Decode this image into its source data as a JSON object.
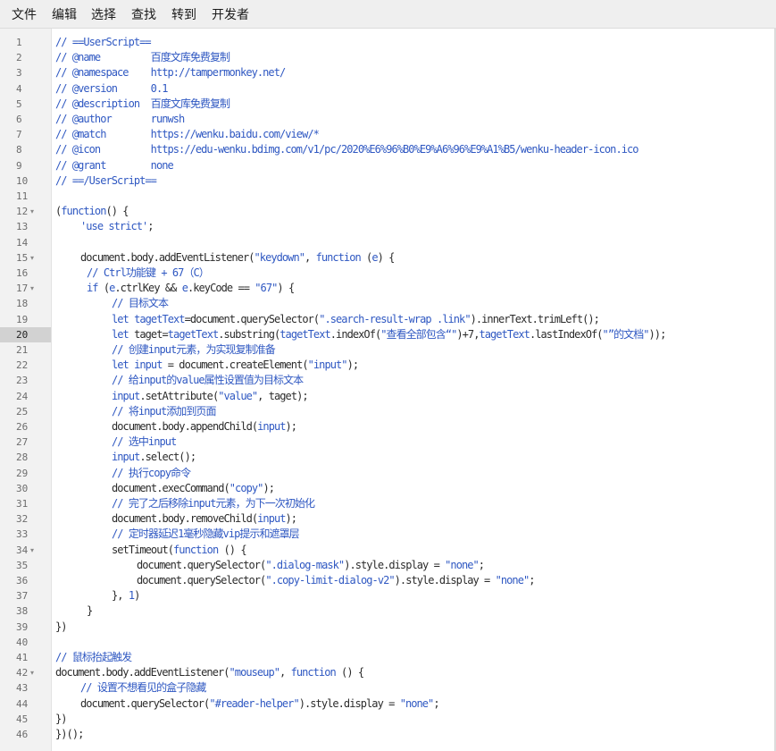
{
  "menu": [
    "文件",
    "编辑",
    "选择",
    "查找",
    "转到",
    "开发者"
  ],
  "active_line": 20,
  "colors": {
    "comment": "#2f58c2",
    "keyword": "#2f58c2",
    "string": "#2f58c2",
    "default": "#2b2b2b"
  },
  "lines": [
    {
      "n": "1",
      "i": 0,
      "t": [
        [
          "// ==UserScript==",
          "c"
        ]
      ]
    },
    {
      "n": "2",
      "i": 0,
      "t": [
        [
          "// @name         百度文库免费复制",
          "c"
        ]
      ]
    },
    {
      "n": "3",
      "i": 0,
      "t": [
        [
          "// @namespace    http://tampermonkey.net/",
          "c"
        ]
      ]
    },
    {
      "n": "4",
      "i": 0,
      "t": [
        [
          "// @version      0.1",
          "c"
        ]
      ]
    },
    {
      "n": "5",
      "i": 0,
      "t": [
        [
          "// @description  百度文库免费复制",
          "c"
        ]
      ]
    },
    {
      "n": "6",
      "i": 0,
      "t": [
        [
          "// @author       runwsh",
          "c"
        ]
      ]
    },
    {
      "n": "7",
      "i": 0,
      "t": [
        [
          "// @match        https://wenku.baidu.com/view/*",
          "c"
        ]
      ]
    },
    {
      "n": "8",
      "i": 0,
      "t": [
        [
          "// @icon         https://edu-wenku.bdimg.com/v1/pc/2020%E6%96%B0%E9%A6%96%E9%A1%B5/wenku-header-icon.ico",
          "c"
        ]
      ]
    },
    {
      "n": "9",
      "i": 0,
      "t": [
        [
          "// @grant        none",
          "c"
        ]
      ]
    },
    {
      "n": "10",
      "i": 0,
      "t": [
        [
          "// ==/UserScript==",
          "c"
        ]
      ]
    },
    {
      "n": "11",
      "i": 0,
      "t": []
    },
    {
      "n": "12",
      "i": 0,
      "fold": true,
      "t": [
        [
          "(",
          "p"
        ],
        [
          "function",
          "k"
        ],
        [
          "() {",
          "p"
        ]
      ]
    },
    {
      "n": "13",
      "i": 1,
      "t": [
        [
          "'use strict'",
          "s"
        ],
        [
          ";",
          "p"
        ]
      ]
    },
    {
      "n": "14",
      "i": 0,
      "t": []
    },
    {
      "n": "15",
      "i": 1,
      "fold": true,
      "t": [
        [
          "document.body.addEventListener(",
          "p"
        ],
        [
          "\"keydown\"",
          "s"
        ],
        [
          ", ",
          "p"
        ],
        [
          "function",
          "k"
        ],
        [
          " (",
          "p"
        ],
        [
          "e",
          "k"
        ],
        [
          ") {",
          "p"
        ]
      ]
    },
    {
      "n": "16",
      "i": 1.25,
      "t": [
        [
          "// Ctrl功能键 + 67（C）",
          "c"
        ]
      ]
    },
    {
      "n": "17",
      "i": 1.25,
      "fold": true,
      "t": [
        [
          "if",
          "k"
        ],
        [
          " (",
          "p"
        ],
        [
          "e",
          "k"
        ],
        [
          ".ctrlKey && ",
          "p"
        ],
        [
          "e",
          "k"
        ],
        [
          ".keyCode == ",
          "p"
        ],
        [
          "\"67\"",
          "s"
        ],
        [
          ") {",
          "p"
        ]
      ]
    },
    {
      "n": "18",
      "i": 2.25,
      "t": [
        [
          "// 目标文本",
          "c"
        ]
      ]
    },
    {
      "n": "19",
      "i": 2.25,
      "t": [
        [
          "let",
          "k"
        ],
        [
          " ",
          "p"
        ],
        [
          "tagetText",
          "k"
        ],
        [
          "=document.querySelector(",
          "p"
        ],
        [
          "\".search-result-wrap .link\"",
          "s"
        ],
        [
          ").innerText.trimLeft();",
          "p"
        ]
      ]
    },
    {
      "n": "20",
      "i": 2.25,
      "t": [
        [
          "let",
          "k"
        ],
        [
          " taget=",
          "p"
        ],
        [
          "tagetText",
          "k"
        ],
        [
          ".substring(",
          "p"
        ],
        [
          "tagetText",
          "k"
        ],
        [
          ".indexOf(",
          "p"
        ],
        [
          "\"查看全部包含“\"",
          "s"
        ],
        [
          ")+7,",
          "p"
        ],
        [
          "tagetText",
          "k"
        ],
        [
          ".lastIndexOf(",
          "p"
        ],
        [
          "\"”的文档\"",
          "s"
        ],
        [
          "));",
          "p"
        ]
      ]
    },
    {
      "n": "21",
      "i": 2.25,
      "t": [
        [
          "// 创建input元素，为实现复制准备",
          "c"
        ]
      ]
    },
    {
      "n": "22",
      "i": 2.25,
      "t": [
        [
          "let",
          "k"
        ],
        [
          " ",
          "p"
        ],
        [
          "input",
          "k"
        ],
        [
          " = document.createElement(",
          "p"
        ],
        [
          "\"input\"",
          "s"
        ],
        [
          ");",
          "p"
        ]
      ]
    },
    {
      "n": "23",
      "i": 2.25,
      "t": [
        [
          "// 给input的value属性设置值为目标文本",
          "c"
        ]
      ]
    },
    {
      "n": "24",
      "i": 2.25,
      "t": [
        [
          "input",
          "k"
        ],
        [
          ".setAttribute(",
          "p"
        ],
        [
          "\"value\"",
          "s"
        ],
        [
          ", taget);",
          "p"
        ]
      ]
    },
    {
      "n": "25",
      "i": 2.25,
      "t": [
        [
          "// 将input添加到页面",
          "c"
        ]
      ]
    },
    {
      "n": "26",
      "i": 2.25,
      "t": [
        [
          "document.body.appendChild(",
          "p"
        ],
        [
          "input",
          "k"
        ],
        [
          ");",
          "p"
        ]
      ]
    },
    {
      "n": "27",
      "i": 2.25,
      "t": [
        [
          "// 选中input",
          "c"
        ]
      ]
    },
    {
      "n": "28",
      "i": 2.25,
      "t": [
        [
          "input",
          "k"
        ],
        [
          ".select();",
          "p"
        ]
      ]
    },
    {
      "n": "29",
      "i": 2.25,
      "t": [
        [
          "// 执行copy命令",
          "c"
        ]
      ]
    },
    {
      "n": "30",
      "i": 2.25,
      "t": [
        [
          "document.execCommand(",
          "p"
        ],
        [
          "\"copy\"",
          "s"
        ],
        [
          ");",
          "p"
        ]
      ]
    },
    {
      "n": "31",
      "i": 2.25,
      "t": [
        [
          "// 完了之后移除input元素，为下一次初始化",
          "c"
        ]
      ]
    },
    {
      "n": "32",
      "i": 2.25,
      "t": [
        [
          "document.body.removeChild(",
          "p"
        ],
        [
          "input",
          "k"
        ],
        [
          ");",
          "p"
        ]
      ]
    },
    {
      "n": "33",
      "i": 2.25,
      "t": [
        [
          "// 定时器延迟1毫秒隐藏vip提示和遮罩层",
          "c"
        ]
      ]
    },
    {
      "n": "34",
      "i": 2.25,
      "fold": true,
      "t": [
        [
          "setTimeout(",
          "p"
        ],
        [
          "function",
          "k"
        ],
        [
          " () {",
          "p"
        ]
      ]
    },
    {
      "n": "35",
      "i": 3.25,
      "t": [
        [
          "document.querySelector(",
          "p"
        ],
        [
          "\".dialog-mask\"",
          "s"
        ],
        [
          ").style.display = ",
          "p"
        ],
        [
          "\"none\"",
          "s"
        ],
        [
          ";",
          "p"
        ]
      ]
    },
    {
      "n": "36",
      "i": 3.25,
      "t": [
        [
          "document.querySelector(",
          "p"
        ],
        [
          "\".copy-limit-dialog-v2\"",
          "s"
        ],
        [
          ").style.display = ",
          "p"
        ],
        [
          "\"none\"",
          "s"
        ],
        [
          ";",
          "p"
        ]
      ]
    },
    {
      "n": "37",
      "i": 2.25,
      "t": [
        [
          "}, ",
          "p"
        ],
        [
          "1",
          "s"
        ],
        [
          ")",
          "p"
        ]
      ]
    },
    {
      "n": "38",
      "i": 1.25,
      "t": [
        [
          "}",
          "p"
        ]
      ]
    },
    {
      "n": "39",
      "i": 0,
      "t": [
        [
          "})",
          "p"
        ]
      ]
    },
    {
      "n": "40",
      "i": 0,
      "t": []
    },
    {
      "n": "41",
      "i": 0,
      "t": [
        [
          "// 鼠标抬起触发",
          "c"
        ]
      ]
    },
    {
      "n": "42",
      "i": 0,
      "fold": true,
      "t": [
        [
          "document.body.addEventListener(",
          "p"
        ],
        [
          "\"mouseup\"",
          "s"
        ],
        [
          ", ",
          "p"
        ],
        [
          "function",
          "k"
        ],
        [
          " () {",
          "p"
        ]
      ]
    },
    {
      "n": "43",
      "i": 1,
      "t": [
        [
          "// 设置不想看见的盒子隐藏",
          "c"
        ]
      ]
    },
    {
      "n": "44",
      "i": 1,
      "t": [
        [
          "document.querySelector(",
          "p"
        ],
        [
          "\"#reader-helper\"",
          "s"
        ],
        [
          ").style.display = ",
          "p"
        ],
        [
          "\"none\"",
          "s"
        ],
        [
          ";",
          "p"
        ]
      ]
    },
    {
      "n": "45",
      "i": 0,
      "t": [
        [
          "})",
          "p"
        ]
      ]
    },
    {
      "n": "46",
      "i": 0,
      "t": [
        [
          "})();",
          "p"
        ]
      ]
    }
  ]
}
